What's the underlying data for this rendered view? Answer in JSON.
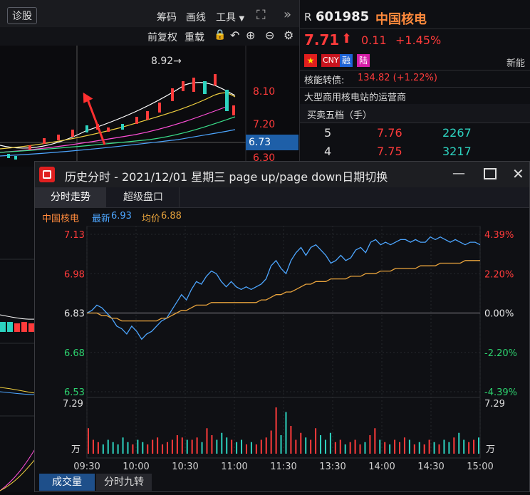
{
  "toolbar": {
    "diagnose_label": "诊股",
    "chips_label": "筹码",
    "draw_label": "画线",
    "tools_label": "工具",
    "prev_adjust_label": "前复权",
    "reload_label": "重载",
    "more_icon": "»"
  },
  "main_chart": {
    "price_labels": [
      "8.10",
      "7.20",
      "6.30"
    ],
    "high_marker": "8.92→",
    "current_price_tag": "6.73"
  },
  "quote": {
    "prefix": "R",
    "code": "601985",
    "name": "中国核电",
    "price": "7.71",
    "change": "0.11",
    "change_pct": "+1.45%",
    "badges": [
      "CNY",
      "融",
      "陆"
    ],
    "new_label": "新能",
    "bond_label": "核能转债:",
    "bond_value": "134.82 (+1.22%)",
    "description": "大型商用核电站的运营商",
    "order_book_title": "买卖五档（手）",
    "order_book": [
      {
        "level": "5",
        "price": "7.76",
        "volume": "2267"
      },
      {
        "level": "4",
        "price": "7.75",
        "volume": "3217"
      }
    ],
    "colors": {
      "up": "#ff3b3b",
      "down": "#2dd36f",
      "accent": "#ff8a3c"
    }
  },
  "window": {
    "title": "历史分时 - 2021/12/01 星期三 page up/page down日期切换",
    "tabs": [
      "分时走势",
      "超级盘口"
    ],
    "info": {
      "name": "中国核电",
      "latest_label": "最新",
      "latest": "6.93",
      "avg_label": "均价",
      "avg": "6.88"
    },
    "bottom_tabs": [
      "成交量",
      "分时九转"
    ]
  },
  "chart_data": {
    "type": "line",
    "title": "",
    "x_ticks": [
      "09:30",
      "10:00",
      "10:30",
      "11:00",
      "11:30",
      "13:30",
      "14:00",
      "14:30",
      "15:00"
    ],
    "y_ticks_left": [
      "7.13",
      "6.98",
      "6.83",
      "6.68",
      "6.53"
    ],
    "y_ticks_right": [
      "4.39%",
      "2.20%",
      "0.00%",
      "-2.20%",
      "-4.39%"
    ],
    "ylim": [
      6.53,
      7.13
    ],
    "prev_close": 6.83,
    "volume_axis_label": "7.29",
    "volume_unit": "万",
    "series": [
      {
        "name": "最新",
        "color": "#4da6ff",
        "values": [
          6.83,
          6.84,
          6.86,
          6.85,
          6.83,
          6.81,
          6.78,
          6.77,
          6.75,
          6.78,
          6.76,
          6.73,
          6.75,
          6.76,
          6.78,
          6.8,
          6.81,
          6.84,
          6.87,
          6.9,
          6.88,
          6.92,
          6.95,
          6.94,
          6.97,
          6.99,
          6.98,
          6.95,
          6.93,
          6.95,
          6.93,
          6.92,
          6.93,
          6.92,
          6.93,
          6.94,
          6.96,
          7.01,
          7.03,
          7.0,
          6.98,
          7.03,
          7.06,
          7.08,
          7.05,
          7.08,
          7.09,
          7.07,
          7.05,
          7.02,
          7.03,
          7.05,
          7.03,
          7.04,
          7.07,
          7.08,
          7.06,
          7.1,
          7.11,
          7.09,
          7.1,
          7.09,
          7.1,
          7.11,
          7.11,
          7.1,
          7.11,
          7.1,
          7.1,
          7.12,
          7.11,
          7.12,
          7.11,
          7.1,
          7.11,
          7.1,
          7.09,
          7.1,
          7.1,
          7.09
        ]
      },
      {
        "name": "均价",
        "color": "#e8a33c",
        "values": [
          6.83,
          6.83,
          6.83,
          6.82,
          6.82,
          6.81,
          6.81,
          6.8,
          6.8,
          6.8,
          6.8,
          6.8,
          6.8,
          6.8,
          6.8,
          6.81,
          6.81,
          6.82,
          6.83,
          6.84,
          6.84,
          6.85,
          6.86,
          6.86,
          6.86,
          6.87,
          6.87,
          6.87,
          6.87,
          6.87,
          6.87,
          6.87,
          6.87,
          6.87,
          6.87,
          6.88,
          6.88,
          6.89,
          6.9,
          6.9,
          6.91,
          6.91,
          6.92,
          6.93,
          6.94,
          6.94,
          6.95,
          6.95,
          6.95,
          6.96,
          6.96,
          6.96,
          6.96,
          6.97,
          6.97,
          6.97,
          6.98,
          6.98,
          6.98,
          6.99,
          6.99,
          6.99,
          7.0,
          7.0,
          7.0,
          7.0,
          7.0,
          7.01,
          7.01,
          7.01,
          7.01,
          7.02,
          7.02,
          7.02,
          7.02,
          7.02,
          7.03,
          7.03,
          7.03,
          7.03
        ]
      }
    ],
    "volume": [
      0.55,
      0.3,
      0.25,
      0.2,
      0.3,
      0.25,
      0.2,
      0.35,
      0.25,
      0.2,
      0.3,
      0.25,
      0.2,
      0.3,
      0.35,
      0.2,
      0.25,
      0.3,
      0.4,
      0.35,
      0.3,
      0.3,
      0.35,
      0.25,
      0.55,
      0.4,
      0.3,
      0.45,
      0.35,
      0.3,
      0.25,
      0.3,
      0.2,
      0.25,
      0.2,
      0.3,
      0.35,
      0.5,
      1.0,
      0.4,
      0.9,
      0.6,
      0.3,
      0.45,
      0.35,
      0.3,
      0.55,
      0.4,
      0.3,
      0.45,
      0.25,
      0.3,
      0.2,
      0.25,
      0.3,
      0.2,
      0.25,
      0.4,
      0.55,
      0.3,
      0.25,
      0.2,
      0.3,
      0.25,
      0.35,
      0.3,
      0.2,
      0.25,
      0.2,
      0.3,
      0.25,
      0.2,
      0.3,
      0.25,
      0.35,
      0.45,
      0.3,
      0.25,
      0.3,
      0.35
    ]
  }
}
